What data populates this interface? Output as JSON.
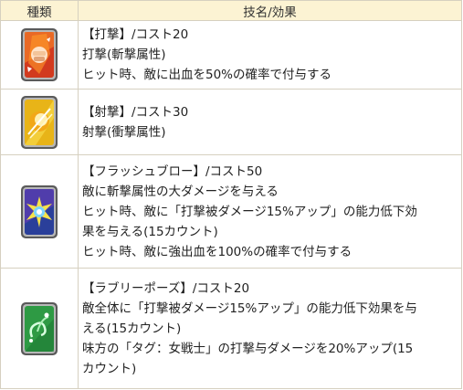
{
  "header": {
    "col_type": "種類",
    "col_skill": "技名/効果"
  },
  "rows": [
    {
      "icon": "red-fist-card-icon",
      "color": "#c8321e",
      "lines": [
        "【打撃】/コスト20",
        "打撃(斬撃属性)",
        "ヒット時、敵に出血を50%の確率で付与する"
      ]
    },
    {
      "icon": "yellow-shot-card-icon",
      "color": "#e0a818",
      "lines": [
        "【射撃】/コスト30",
        "射撃(衝撃属性)"
      ]
    },
    {
      "icon": "blue-flash-card-icon",
      "color": "#3a5fc8",
      "lines": [
        "【フラッシュブロー】/コスト50",
        "敵に斬撃属性の大ダメージを与える",
        "ヒット時、敵に「打撃被ダメージ15%アップ」の能力低下効",
        "果を与える(15カウント)",
        "ヒット時、敵に強出血を100%の確率で付与する"
      ]
    },
    {
      "icon": "green-pose-card-icon",
      "color": "#3aa84a",
      "lines": [
        "【ラブリーポーズ】/コスト20",
        "敵全体に「打撃被ダメージ15%アップ」の能力低下効果を与",
        "える(15カウント)",
        "味方の「タグ：女戦士」の打撃与ダメージを20%アップ(15",
        "カウント)"
      ]
    }
  ]
}
